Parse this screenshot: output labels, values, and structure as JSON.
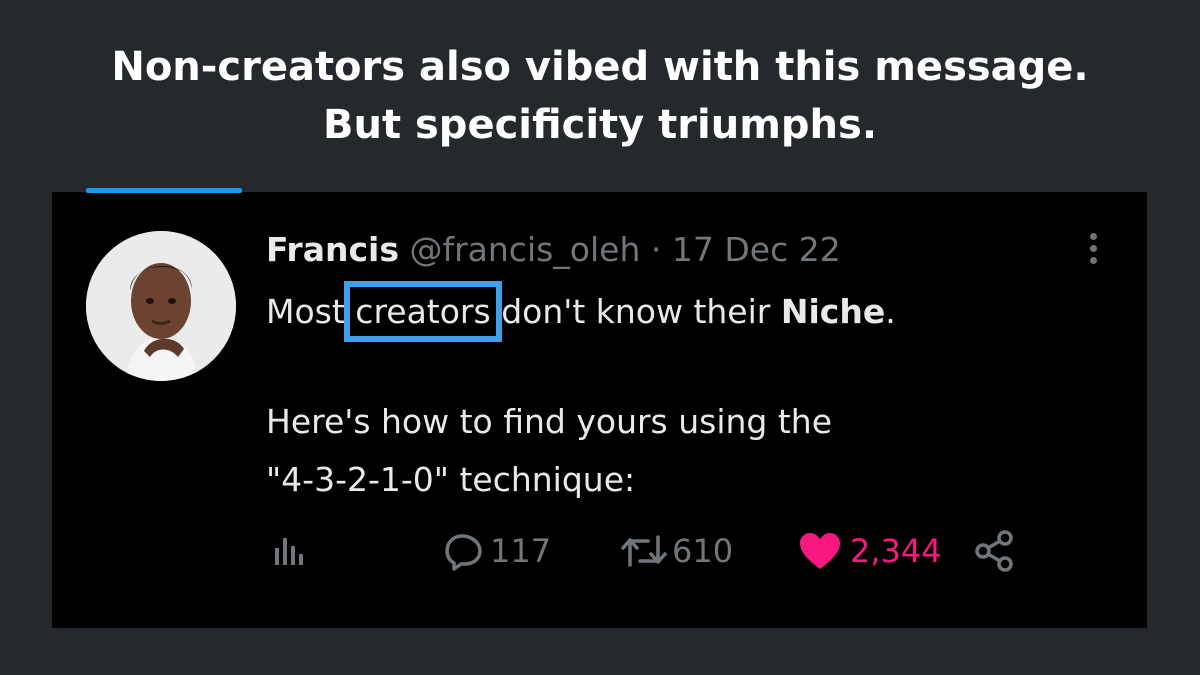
{
  "headline": {
    "line1": "Non-creators also vibed with this message.",
    "line2": "But specificity triumphs."
  },
  "tweet": {
    "author_name": "Francis",
    "handle": "@francis_oleh",
    "separator": "·",
    "date": "17 Dec 22",
    "text": {
      "part1": "Most ",
      "highlight": "creators",
      "part2": " don't know their ",
      "bold": "Niche",
      "part3": ".",
      "line2": "Here's how to find yours using the",
      "line3": "\"4-3-2-1-0\" technique:"
    },
    "actions": {
      "replies": "117",
      "retweets": "610",
      "likes": "2,344"
    }
  },
  "colors": {
    "page_background": "#25292d",
    "card_background": "#000000",
    "accent_blue": "#3f9fe9",
    "like_pink": "#f91880",
    "muted_text": "#71767b"
  },
  "icons": [
    "more-vertical-icon",
    "analytics-icon",
    "reply-icon",
    "retweet-icon",
    "heart-icon",
    "share-icon"
  ]
}
